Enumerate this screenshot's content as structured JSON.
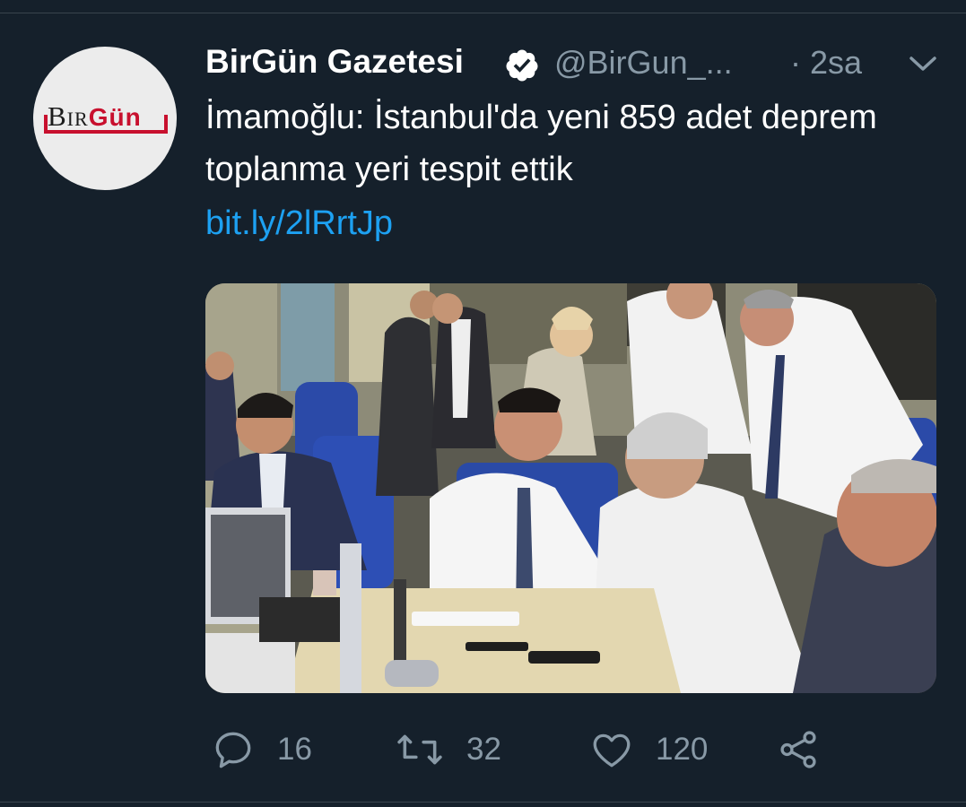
{
  "tweet": {
    "display_name": "BirGün Gazetesi",
    "handle": "@BirGun_...",
    "time": "· 2sa",
    "text": "İmamoğlu: İstanbul'da yeni 859 adet deprem toplanma yeri tespit ettik",
    "link": "bit.ly/2lRrtJp",
    "verified_icon": "verified-badge-icon",
    "more_icon": "chevron-down-icon"
  },
  "avatar": {
    "logo_part1": "Bir",
    "logo_part2": "Gün",
    "brand_color": "#c8102e"
  },
  "actions": {
    "reply_count": "16",
    "retweet_count": "32",
    "like_count": "120"
  },
  "colors": {
    "background": "#15202b",
    "secondary_text": "#8899a6",
    "link": "#1da1f2",
    "divider": "#38444d"
  }
}
